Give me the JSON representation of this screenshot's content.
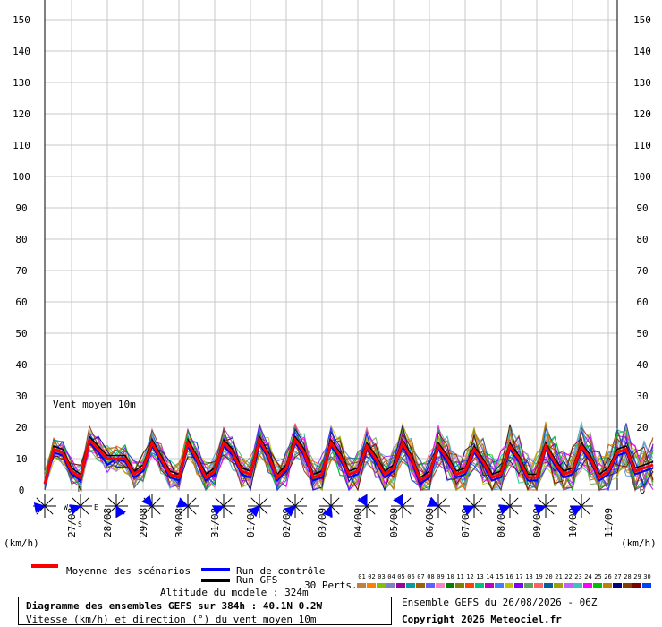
{
  "chart_data": {
    "type": "line",
    "annotation": "Vent moyen 10m",
    "ylim": [
      0,
      150
    ],
    "yticks": [
      0,
      10,
      20,
      30,
      40,
      50,
      60,
      70,
      80,
      90,
      100,
      110,
      120,
      130,
      140,
      150
    ],
    "unit_left": "(km/h)",
    "unit_right": "(km/h)",
    "x_dates": [
      "27/08",
      "28/08",
      "29/08",
      "30/08",
      "31/08",
      "01/09",
      "02/09",
      "03/09",
      "04/09",
      "05/09",
      "06/09",
      "07/09",
      "08/09",
      "09/09",
      "10/09",
      "11/09"
    ],
    "x_range_hours": [
      0,
      384
    ],
    "step_hours": 6,
    "series": [
      {
        "name": "Moyenne des scénarios",
        "color": "#ff0000",
        "values": [
          2,
          13,
          12,
          6,
          4,
          16,
          13,
          10,
          10,
          10,
          5,
          7,
          15,
          10,
          5,
          4,
          15,
          10,
          4,
          6,
          15,
          12,
          6,
          5,
          16,
          11,
          4,
          7,
          16,
          12,
          4,
          5,
          15,
          11,
          5,
          6,
          14,
          10,
          5,
          7,
          15,
          10,
          3,
          5,
          14,
          10,
          5,
          6,
          13,
          9,
          4,
          5,
          14,
          10,
          4,
          4,
          14,
          9,
          5,
          6,
          14,
          10,
          4,
          6,
          12,
          13,
          6,
          7,
          8
        ]
      },
      {
        "name": "Run de contrôle",
        "color": "#0000ff",
        "values": [
          2,
          12,
          11,
          5,
          3,
          15,
          12,
          8,
          10,
          9,
          4,
          6,
          14,
          9,
          4,
          3,
          14,
          9,
          3,
          5,
          14,
          11,
          5,
          4,
          15,
          10,
          3,
          6,
          15,
          11,
          3,
          4,
          14,
          10,
          4,
          5,
          13,
          9,
          4,
          6,
          14,
          9,
          2,
          4,
          13,
          9,
          4,
          5,
          12,
          8,
          3,
          4,
          13,
          9,
          3,
          3,
          13,
          8,
          4,
          5,
          13,
          9,
          3,
          5,
          11,
          12,
          5,
          6,
          7
        ]
      },
      {
        "name": "Run GFS",
        "color": "#000000",
        "values": [
          2,
          14,
          13,
          7,
          5,
          17,
          14,
          11,
          11,
          11,
          6,
          8,
          16,
          11,
          6,
          5,
          16,
          11,
          5,
          7,
          16,
          13,
          7,
          6,
          17,
          12,
          5,
          8,
          17,
          13,
          5,
          6,
          16,
          12,
          6,
          7,
          15,
          11,
          6,
          8,
          16,
          11,
          4,
          6,
          15,
          11,
          6,
          7,
          14,
          10,
          5,
          6,
          15,
          11,
          5,
          5,
          15,
          10,
          6,
          7,
          15,
          11,
          5,
          7,
          13,
          14,
          7,
          8,
          9
        ]
      }
    ],
    "wind_direction_deg": [
      260,
      250,
      150,
      320,
      290,
      245,
      225,
      230,
      200,
      330,
      330,
      295,
      245,
      250,
      250,
      240
    ],
    "compass_labels": [
      "N",
      "S",
      "W",
      "E"
    ]
  },
  "legend": {
    "mean_label": "Moyenne des scénarios",
    "control_label": "Run de contrôle",
    "gfs_label": "Run GFS",
    "altitude": "Altitude du modele : 324m",
    "perts_label": "30 Perts.",
    "pert_numbers": [
      "01",
      "02",
      "03",
      "04",
      "05",
      "06",
      "07",
      "08",
      "09",
      "10",
      "11",
      "12",
      "13",
      "14",
      "15",
      "16",
      "17",
      "18",
      "19",
      "20",
      "21",
      "22",
      "23",
      "24",
      "25",
      "26",
      "27",
      "28",
      "29",
      "30"
    ],
    "pert_colors": [
      "#c08040",
      "#ff8000",
      "#80c000",
      "#8080c0",
      "#a000a0",
      "#00a0a0",
      "#a06000",
      "#6060ff",
      "#ff80c0",
      "#008000",
      "#808000",
      "#ff4000",
      "#00c080",
      "#c000c0",
      "#4080ff",
      "#c0c000",
      "#8000ff",
      "#60a060",
      "#ff6060",
      "#0060a0",
      "#a0a000",
      "#c060ff",
      "#40c0c0",
      "#ff00ff",
      "#00c000",
      "#c08000",
      "#000080",
      "#804000",
      "#800000",
      "#0040ff"
    ],
    "ensemble_info": "Ensemble GEFS du 26/08/2026 - 06Z",
    "copyright": "Copyright 2026 Meteociel.fr"
  },
  "info_box": {
    "title": "Diagramme des ensembles GEFS sur 384h : 40.1N 0.2W",
    "subtitle": "Vitesse (km/h) et direction (°) du vent moyen 10m"
  }
}
